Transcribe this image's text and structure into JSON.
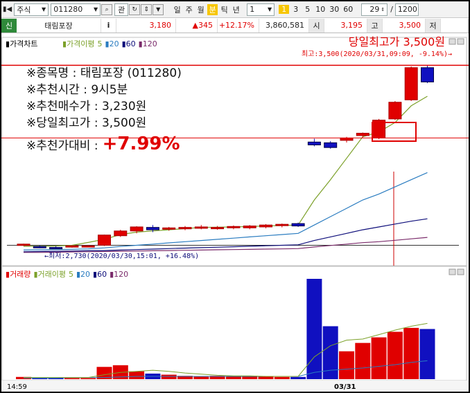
{
  "toolbar": {
    "market": "주식",
    "code": "011280",
    "view_label": "관",
    "periods": [
      "일",
      "주",
      "월",
      "분",
      "틱",
      "년"
    ],
    "period_value": "1",
    "minute_badge": "1",
    "intervals": [
      "3",
      "5",
      "10",
      "30",
      "60"
    ],
    "count": "29",
    "count_unit": "/",
    "display_count": "1200"
  },
  "quote": {
    "tag": "신",
    "name": "태림포장",
    "info": "i",
    "price": "3,180",
    "change": "▲345",
    "change_pct": "+12.17%",
    "volume": "3,860,581",
    "open_label": "시",
    "open_value": "3,195",
    "high_label": "고",
    "high_value": "3,500",
    "low_label": "저"
  },
  "price_panel": {
    "legend": [
      "가격차트",
      "가격이평",
      "5",
      "20",
      "60",
      "120"
    ],
    "high_annotation": "당일최고가 3,500원",
    "high_marker": "최고:3,500(2020/03/31,09:09, -9.14%)→",
    "low_marker": "←최저:2,730(2020/03/30,15:01, +16.48%)"
  },
  "volume_panel": {
    "legend": [
      "거래량",
      "거래이평",
      "5",
      "20",
      "60",
      "120"
    ]
  },
  "info_box": {
    "line1": "※종목명 : 태림포장 (011280)",
    "line2": "※추천시간 : 9시5분",
    "line3": "※추천매수가 : 3,230원",
    "line4": "※당일최고가 : 3,500원",
    "line5_label": "※추천가대비 :",
    "line5_value": "+7.99%"
  },
  "x_axis": {
    "left_tick": "14:59",
    "right_tick": "03/31"
  },
  "colors": {
    "up": "#e00000",
    "down": "#1010c0",
    "ma5": "#7ca12a",
    "ma20": "#2a7cc0",
    "ma60": "#0d0d7a",
    "ma120": "#7a2a6a",
    "accent": "#f7c600"
  },
  "chart_data": {
    "type": "candlestick",
    "price_range": [
      2700,
      3530
    ],
    "reference_lines": [
      3500,
      3195
    ],
    "recommendation_time": "09:05",
    "candles": [
      {
        "open": 2748,
        "high": 2752,
        "low": 2742,
        "close": 2750
      },
      {
        "open": 2740,
        "high": 2745,
        "low": 2733,
        "close": 2738
      },
      {
        "open": 2736,
        "high": 2741,
        "low": 2730,
        "close": 2735
      },
      {
        "open": 2740,
        "high": 2745,
        "low": 2735,
        "close": 2743
      },
      {
        "open": 2741,
        "high": 2745,
        "low": 2737,
        "close": 2743
      },
      {
        "open": 2745,
        "high": 2790,
        "low": 2742,
        "close": 2788
      },
      {
        "open": 2785,
        "high": 2810,
        "low": 2780,
        "close": 2805
      },
      {
        "open": 2805,
        "high": 2825,
        "low": 2795,
        "close": 2822
      },
      {
        "open": 2820,
        "high": 2830,
        "low": 2800,
        "close": 2810
      },
      {
        "open": 2812,
        "high": 2822,
        "low": 2806,
        "close": 2818
      },
      {
        "open": 2814,
        "high": 2826,
        "low": 2808,
        "close": 2820
      },
      {
        "open": 2818,
        "high": 2830,
        "low": 2812,
        "close": 2822
      },
      {
        "open": 2816,
        "high": 2826,
        "low": 2810,
        "close": 2820
      },
      {
        "open": 2818,
        "high": 2828,
        "low": 2812,
        "close": 2824
      },
      {
        "open": 2818,
        "high": 2830,
        "low": 2812,
        "close": 2826
      },
      {
        "open": 2822,
        "high": 2834,
        "low": 2816,
        "close": 2830
      },
      {
        "open": 2828,
        "high": 2836,
        "low": 2820,
        "close": 2833
      },
      {
        "open": 2836,
        "high": 2840,
        "low": 2822,
        "close": 2826
      },
      {
        "open": 3178,
        "high": 3192,
        "low": 3160,
        "close": 3166
      },
      {
        "open": 3175,
        "high": 3182,
        "low": 3150,
        "close": 3155
      },
      {
        "open": 3185,
        "high": 3200,
        "low": 3176,
        "close": 3195
      },
      {
        "open": 3205,
        "high": 3218,
        "low": 3198,
        "close": 3215
      },
      {
        "open": 3195,
        "high": 3275,
        "low": 3190,
        "close": 3270
      },
      {
        "open": 3275,
        "high": 3350,
        "low": 3270,
        "close": 3345
      },
      {
        "open": 3355,
        "high": 3495,
        "low": 3350,
        "close": 3490
      },
      {
        "open": 3490,
        "high": 3500,
        "low": 3425,
        "close": 3430
      }
    ],
    "ma5": [
      2741,
      2741,
      2742,
      2745,
      2757,
      2770,
      2790,
      2800,
      2805,
      2810,
      2815,
      2820,
      2821,
      2822,
      2824,
      2826,
      2828,
      2830,
      2935,
      3020,
      3110,
      3200,
      3220,
      3260,
      3330,
      3370
    ],
    "ma20": [
      2725,
      2726,
      2727,
      2728,
      2730,
      2734,
      2740,
      2745,
      2750,
      2755,
      2760,
      2765,
      2770,
      2775,
      2780,
      2785,
      2790,
      2795,
      2830,
      2865,
      2900,
      2935,
      2960,
      2990,
      3020,
      3050
    ],
    "ma60": [
      2718,
      2719,
      2720,
      2721,
      2722,
      2723,
      2725,
      2727,
      2729,
      2731,
      2733,
      2735,
      2737,
      2739,
      2741,
      2743,
      2745,
      2747,
      2765,
      2780,
      2795,
      2810,
      2822,
      2834,
      2846,
      2856
    ],
    "ma120": [
      2715,
      2715,
      2716,
      2717,
      2718,
      2719,
      2720,
      2721,
      2722,
      2723,
      2724,
      2725,
      2726,
      2727,
      2728,
      2729,
      2730,
      2731,
      2738,
      2744,
      2750,
      2756,
      2760,
      2766,
      2772,
      2778
    ],
    "volume": {
      "range": [
        0,
        180
      ],
      "bars": [
        4,
        3,
        2,
        2,
        2,
        22,
        25,
        14,
        10,
        8,
        6,
        5,
        6,
        5,
        6,
        5,
        4,
        4,
        180,
        95,
        50,
        65,
        75,
        85,
        92,
        90
      ],
      "ma5": [
        3,
        3,
        3,
        3,
        3,
        8,
        12,
        14,
        16,
        14,
        11,
        9,
        7,
        6,
        6,
        5,
        5,
        5,
        40,
        60,
        70,
        72,
        80,
        88,
        95,
        100
      ],
      "ma20": [
        2,
        2,
        2,
        3,
        3,
        3,
        4,
        5,
        5,
        5,
        5,
        5,
        5,
        5,
        5,
        5,
        5,
        5,
        12,
        16,
        18,
        20,
        23,
        26,
        30,
        33
      ]
    }
  }
}
